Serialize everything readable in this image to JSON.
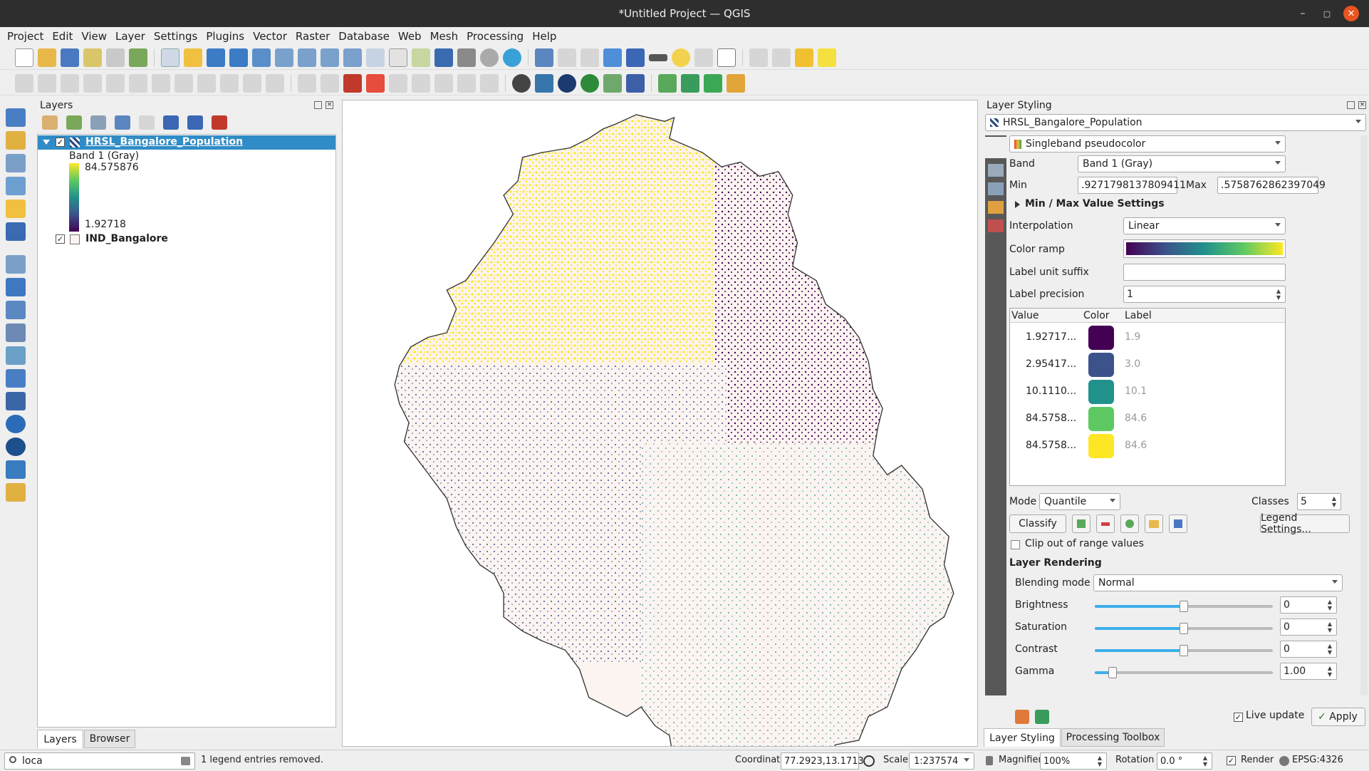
{
  "window": {
    "title": "*Untitled Project — QGIS",
    "minimize": "–",
    "maximize": "▢",
    "close": "✕"
  },
  "menu": [
    "Project",
    "Edit",
    "View",
    "Layer",
    "Settings",
    "Plugins",
    "Vector",
    "Raster",
    "Database",
    "Web",
    "Mesh",
    "Processing",
    "Help"
  ],
  "layers_panel": {
    "title": "Layers",
    "layers": [
      {
        "name": "HRSL_Bangalore_Population",
        "checked": true,
        "band": "Band 1 (Gray)",
        "max": "84.575876",
        "min": "1.92718"
      },
      {
        "name": "IND_Bangalore",
        "checked": true
      }
    ],
    "tabs": [
      "Layers",
      "Browser"
    ]
  },
  "styling": {
    "title": "Layer Styling",
    "layer": "HRSL_Bangalore_Population",
    "renderer": "Singleband pseudocolor",
    "band_label": "Band",
    "band": "Band 1 (Gray)",
    "min_label": "Min",
    "min": ".9271798137809411",
    "max_label": "Max",
    "max": ".5758762862397049",
    "minmax_settings": "Min / Max Value Settings",
    "interpolation_label": "Interpolation",
    "interpolation": "Linear",
    "color_ramp_label": "Color ramp",
    "label_suffix_label": "Label unit suffix",
    "label_suffix": "",
    "label_precision_label": "Label precision",
    "label_precision": "1",
    "table_headers": [
      "Value",
      "Color",
      "Label"
    ],
    "classes": [
      {
        "value": "1.92717...",
        "color": "#440154",
        "label": "1.9"
      },
      {
        "value": "2.95417...",
        "color": "#3b528b",
        "label": "3.0"
      },
      {
        "value": "10.1110...",
        "color": "#21918c",
        "label": "10.1"
      },
      {
        "value": "84.5758...",
        "color": "#5ec962",
        "label": "84.6"
      },
      {
        "value": "84.5758...",
        "color": "#fde725",
        "label": "84.6"
      }
    ],
    "mode_label": "Mode",
    "mode": "Quantile",
    "classes_label": "Classes",
    "classes_count": "5",
    "classify": "Classify",
    "legend_settings": "Legend Settings...",
    "clip_label": "Clip out of range values",
    "layer_rendering": "Layer Rendering",
    "blending_label": "Blending mode",
    "blending": "Normal",
    "brightness_label": "Brightness",
    "brightness": "0",
    "brightness_level": 0.5,
    "saturation_label": "Saturation",
    "saturation": "0",
    "saturation_level": 0.5,
    "contrast_label": "Contrast",
    "contrast": "0",
    "contrast_level": 0.5,
    "gamma_label": "Gamma",
    "gamma": "1.00",
    "gamma_level": 0.1,
    "live_update": "Live update",
    "apply": "Apply",
    "tabs": [
      "Layer Styling",
      "Processing Toolbox"
    ]
  },
  "status": {
    "search": "loca",
    "message": "1 legend entries removed.",
    "coordinate_label": "Coordinate",
    "coordinate": "77.2923,13.1713",
    "scale_label": "Scale",
    "scale": "1:237574",
    "magnifier_label": "Magnifier",
    "magnifier": "100%",
    "rotation_label": "Rotation",
    "rotation": "0.0 °",
    "render_label": "Render",
    "crs": "EPSG:4326"
  },
  "colors": {
    "accent": "#308cc6",
    "ramp": [
      "#440154",
      "#3b528b",
      "#21918c",
      "#5ec962",
      "#fde725"
    ],
    "map_fill": "#fcf4f1"
  }
}
